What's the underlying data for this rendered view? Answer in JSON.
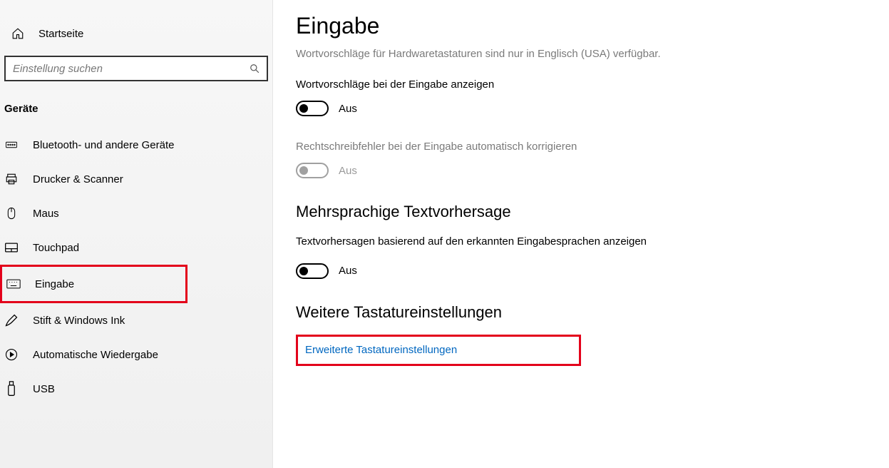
{
  "sidebar": {
    "home_label": "Startseite",
    "search_placeholder": "Einstellung suchen",
    "category": "Geräte",
    "items": [
      {
        "icon": "bluetooth",
        "label": "Bluetooth- und andere Geräte"
      },
      {
        "icon": "printer",
        "label": "Drucker & Scanner"
      },
      {
        "icon": "mouse",
        "label": "Maus"
      },
      {
        "icon": "touchpad",
        "label": "Touchpad"
      },
      {
        "icon": "keyboard",
        "label": "Eingabe",
        "highlighted": true
      },
      {
        "icon": "pen",
        "label": "Stift & Windows Ink"
      },
      {
        "icon": "autoplay",
        "label": "Automatische Wiedergabe"
      },
      {
        "icon": "usb",
        "label": "USB"
      }
    ]
  },
  "main": {
    "title": "Eingabe",
    "hw_note": "Wortvorschläge für Hardwaretastaturen sind nur in Englisch (USA) verfügbar.",
    "option1": {
      "label": "Wortvorschläge bei der Eingabe anzeigen",
      "state_text": "Aus"
    },
    "option2": {
      "label": "Rechtschreibfehler bei der Eingabe automatisch korrigieren",
      "state_text": "Aus"
    },
    "sectionA": {
      "header": "Mehrsprachige Textvorhersage",
      "body": "Textvorhersagen basierend auf den erkannten Eingabesprachen anzeigen",
      "state_text": "Aus"
    },
    "sectionB": {
      "header": "Weitere Tastatureinstellungen",
      "link": "Erweiterte Tastatureinstellungen"
    }
  }
}
